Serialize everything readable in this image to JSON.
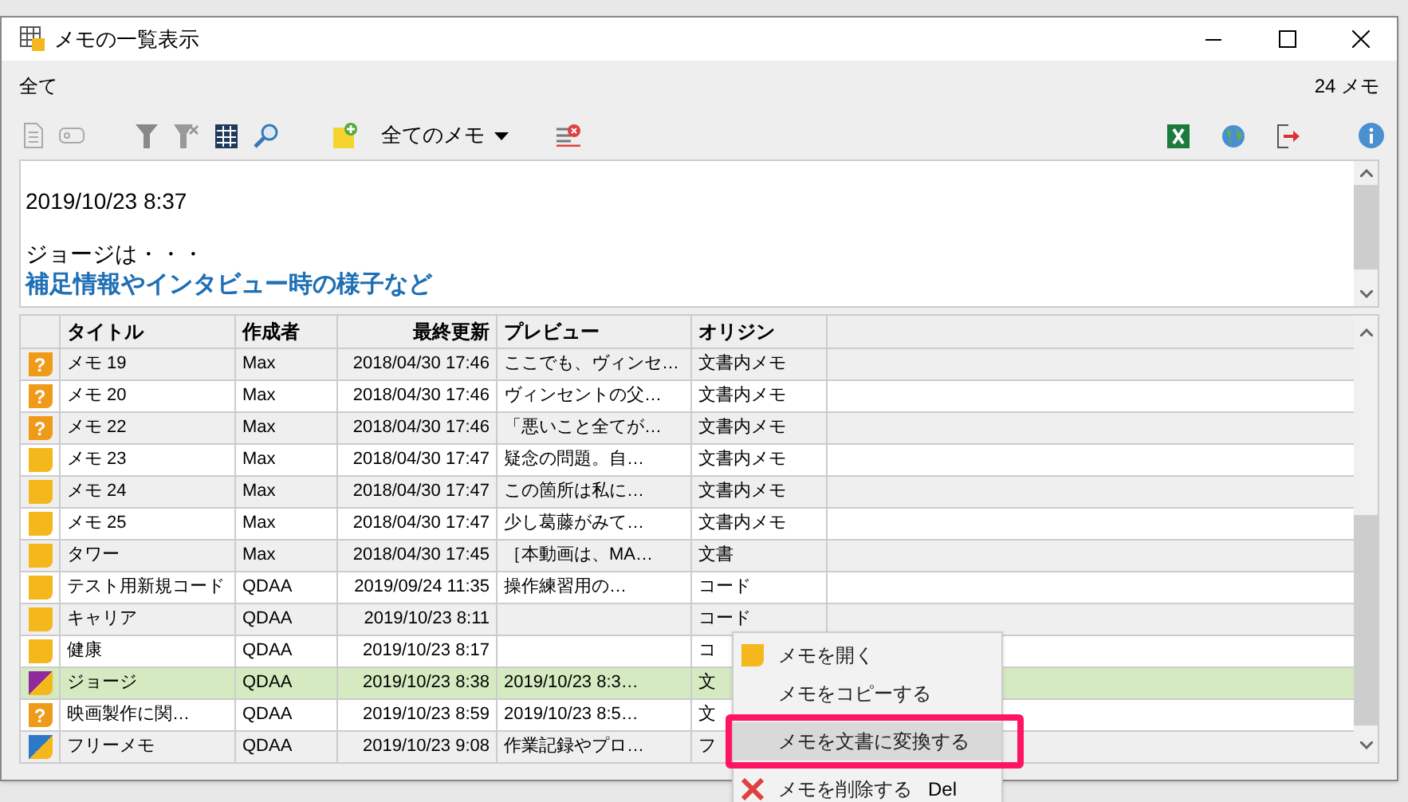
{
  "window": {
    "title": "メモの一覧表示"
  },
  "filter_label": "全て",
  "count": "24 メモ",
  "toolbar": {
    "dropdown": "全てのメモ"
  },
  "preview": [
    {
      "kind": "plain",
      "text": "2019/10/23 8:37"
    },
    {
      "kind": "blank"
    },
    {
      "kind": "plain",
      "text": "ジョージは・・・"
    },
    {
      "kind": "heading",
      "text": "補足情報やインタビュー時の様子など"
    }
  ],
  "table": {
    "columns": [
      "タイトル",
      "作成者",
      "最終更新",
      "プレビュー",
      "オリジン"
    ],
    "rows": [
      {
        "kind": "question",
        "mark": "?",
        "title": "メモ 19",
        "author": "Max",
        "updated": "2018/04/30 17:46",
        "preview": "ここでも、ヴィンセ…",
        "origin": "文書内メモ",
        "selected": false
      },
      {
        "kind": "question",
        "mark": "?",
        "title": "メモ 20",
        "author": "Max",
        "updated": "2018/04/30 17:46",
        "preview": "ヴィンセントの父…",
        "origin": "文書内メモ",
        "selected": false
      },
      {
        "kind": "question",
        "mark": "?",
        "title": "メモ 22",
        "author": "Max",
        "updated": "2018/04/30 17:46",
        "preview": "「悪いこと全てが…",
        "origin": "文書内メモ",
        "selected": false
      },
      {
        "kind": "note",
        "title": "メモ 23",
        "author": "Max",
        "updated": "2018/04/30 17:47",
        "preview": "疑念の問題。自…",
        "origin": "文書内メモ",
        "selected": false
      },
      {
        "kind": "note",
        "title": "メモ 24",
        "author": "Max",
        "updated": "2018/04/30 17:47",
        "preview": "この箇所は私に…",
        "origin": "文書内メモ",
        "selected": false
      },
      {
        "kind": "note",
        "title": "メモ 25",
        "author": "Max",
        "updated": "2018/04/30 17:47",
        "preview": "少し葛藤がみて…",
        "origin": "文書内メモ",
        "selected": false
      },
      {
        "kind": "note",
        "title": "タワー",
        "author": "Max",
        "updated": "2018/04/30 17:45",
        "preview": "［本動画は、MA…",
        "origin": "文書",
        "selected": false
      },
      {
        "kind": "note",
        "title": "テスト用新規コード",
        "author": "QDAA",
        "updated": "2019/09/24 11:35",
        "preview": "操作練習用の…",
        "origin": "コード",
        "selected": false
      },
      {
        "kind": "note",
        "title": "キャリア",
        "author": "QDAA",
        "updated": "2019/10/23 8:11",
        "origin": "コード",
        "selected": false
      },
      {
        "kind": "note",
        "title": "健康",
        "author": "QDAA",
        "updated": "2019/10/23 8:17",
        "origin": "コ",
        "selected": false
      },
      {
        "kind": "split_purple",
        "title": "ジョージ",
        "author": "QDAA",
        "updated": "2019/10/23 8:38",
        "preview": "2019/10/23 8:3…",
        "origin": "文",
        "selected": true
      },
      {
        "kind": "question",
        "mark": "?",
        "title": "映画製作に関…",
        "author": "QDAA",
        "updated": "2019/10/23 8:59",
        "preview": "2019/10/23 8:5…",
        "origin": "文",
        "selected": false
      },
      {
        "kind": "split_blue",
        "title": "フリーメモ",
        "author": "QDAA",
        "updated": "2019/10/23 9:08",
        "preview": "作業記録やプロ…",
        "origin": "フ",
        "selected": false
      }
    ]
  },
  "context_menu": [
    {
      "kind": "note",
      "label": "メモを開く",
      "highlighted": false,
      "outlined": false
    },
    {
      "kind": "plain",
      "label": "メモをコピーする",
      "highlighted": false,
      "outlined": false
    },
    {
      "kind": "plain",
      "label": "メモを文書に変換する",
      "highlighted": true,
      "outlined": true
    },
    {
      "kind": "delete",
      "label": "メモを削除する",
      "shortcut": "Del",
      "highlighted": false,
      "outlined": false
    }
  ]
}
